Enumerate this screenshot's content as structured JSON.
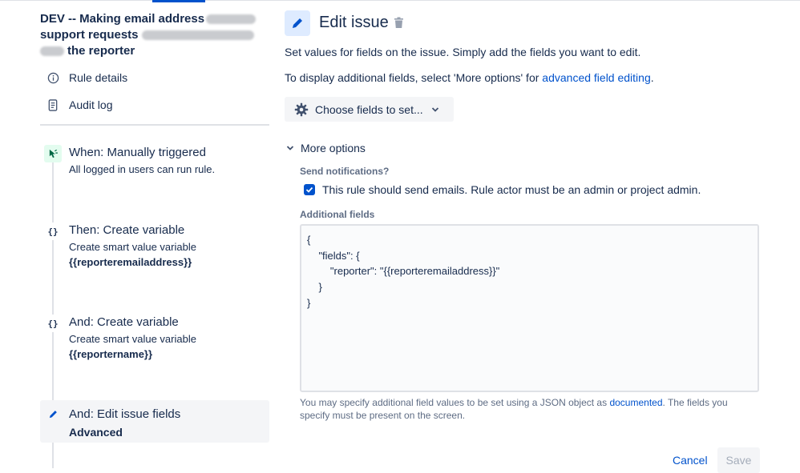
{
  "rule": {
    "title_line1": "DEV -- Making email address",
    "title_line2": "support requests",
    "title_line3": "the reporter"
  },
  "nav": {
    "rule_details": "Rule details",
    "audit_log": "Audit log"
  },
  "components": [
    {
      "title": "When: Manually triggered",
      "sub": "All logged in users can run rule.",
      "bold": ""
    },
    {
      "title": "Then: Create variable",
      "sub": "Create smart value variable",
      "bold": "{{reporteremailaddress}}"
    },
    {
      "title": "And: Create variable",
      "sub": "Create smart value variable",
      "bold": "{{reportername}}"
    },
    {
      "title": "And: Edit issue fields",
      "sub": "",
      "bold": "Advanced"
    }
  ],
  "icons": {
    "trigger": "cursor-icon",
    "variable": "braces-icon",
    "edit": "pencil-icon"
  },
  "badge_glyph": "{}",
  "editor": {
    "title": "Edit issue",
    "desc1": "Set values for fields on the issue. Simply add the fields you want to edit.",
    "desc2_prefix": "To display additional fields, select 'More options' for ",
    "desc2_link": "advanced field editing",
    "desc2_suffix": ".",
    "choose_fields": "Choose fields to set...",
    "more_options": "More options",
    "send_notifications_label": "Send notifications?",
    "send_notifications_text": "This rule should send emails. Rule actor must be an admin or project admin.",
    "additional_fields_label": "Additional fields",
    "additional_fields_value": "{\n    \"fields\": {\n        \"reporter\": \"{{reporteremailaddress}}\"\n    }\n}",
    "help_prefix": "You may specify additional field values to be set using a JSON object as ",
    "help_link": "documented",
    "help_suffix": ". The fields you specify must be present on the screen.",
    "cancel": "Cancel",
    "save": "Save"
  },
  "colors": {
    "accent": "#0052cc",
    "trigger_badge": "#e3fcef",
    "trigger_icon": "#006644",
    "edit_badge": "#deebff"
  }
}
